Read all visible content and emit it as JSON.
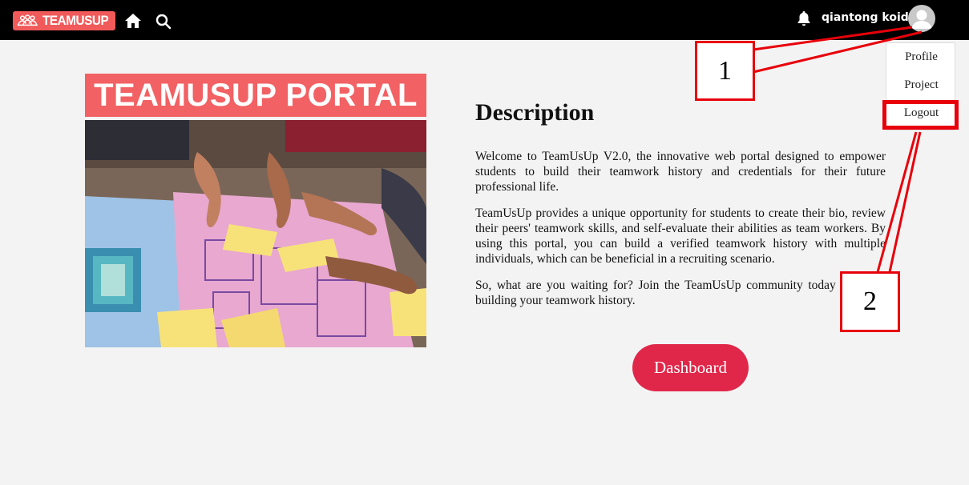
{
  "nav": {
    "brand": "TEAMUSUP",
    "user_name": "qiantong koid"
  },
  "dropdown": {
    "items": [
      "Profile",
      "Project",
      "Logout"
    ]
  },
  "hero": {
    "banner": "TEAMUSUP PORTAL"
  },
  "description": {
    "title": "Description",
    "paragraphs": [
      "Welcome to TeamUsUp V2.0, the innovative web portal designed to empower students to build their teamwork history and credentials for their future professional life.",
      "TeamUsUp provides a unique opportunity for students to create their bio, review their peers' teamwork skills, and self-evaluate their abilities as team workers. By using this portal, you can build a verified teamwork history with multiple individuals, which can be beneficial in a recruiting scenario.",
      "So, what are you waiting for? Join the TeamUsUp community today and start building your teamwork history."
    ]
  },
  "dashboard_label": "Dashboard",
  "annotations": [
    "1",
    "2"
  ],
  "colors": {
    "nav_bg": "#000000",
    "brand_red": "#f05a5a",
    "button_red": "#e0274a",
    "annotation_red": "#e8000a",
    "page_bg": "#f3f3f3"
  },
  "icons": [
    "teamusup-logo-icon",
    "home-icon",
    "search-icon",
    "bell-icon",
    "user-avatar-icon"
  ]
}
